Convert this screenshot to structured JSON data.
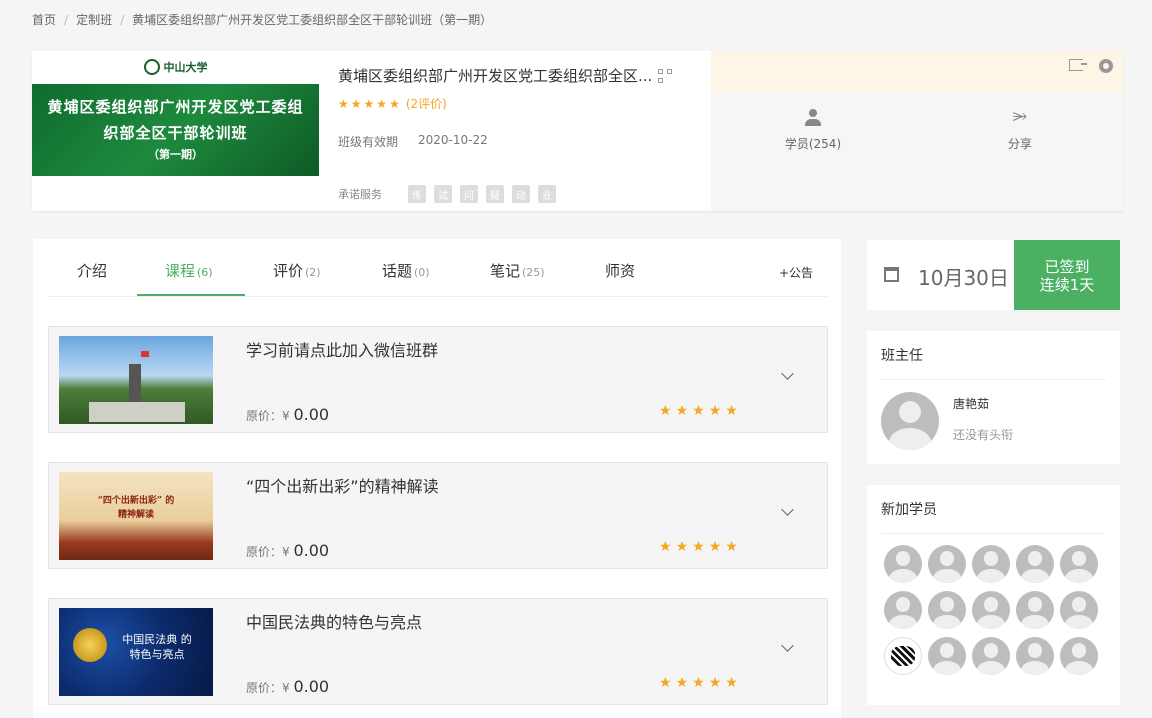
{
  "breadcrumb": {
    "home": "首页",
    "section": "定制班",
    "current": "黄埔区委组织部广州开发区党工委组织部全区干部轮训班（第一期）"
  },
  "cover": {
    "logo_text": "中山大学",
    "title_line1": "黄埔区委组织部广州开发区党工委组",
    "title_line2": "织部全区干部轮训班",
    "subtitle": "（第一期）"
  },
  "info": {
    "title": "黄埔区委组织部广州开发区党工委组织部全区...",
    "rating": 5,
    "rating_text": "(2评价)",
    "validity_label": "班级有效期",
    "validity_value": "2020-10-22",
    "promise_label": "承诺服务",
    "promise_badges": [
      "练",
      "试",
      "问",
      "疑",
      "动",
      "业"
    ]
  },
  "actions": {
    "students_label": "学员(254)",
    "share_label": "分享"
  },
  "tabs": [
    {
      "label": "介绍",
      "count": ""
    },
    {
      "label": "课程",
      "count": "(6)"
    },
    {
      "label": "评价",
      "count": "(2)"
    },
    {
      "label": "话题",
      "count": "(0)"
    },
    {
      "label": "笔记",
      "count": "(25)"
    },
    {
      "label": "师资",
      "count": ""
    }
  ],
  "notice_label": "+公告",
  "courses": [
    {
      "title": "学习前请点此加入微信班群",
      "price_label": "原价：¥",
      "price": "0.00",
      "rating": 5
    },
    {
      "title": "“四个出新出彩”的精神解读",
      "price_label": "原价：¥",
      "price": "0.00",
      "rating": 5,
      "thumb_text": "“四个出新出彩” 的精神解读"
    },
    {
      "title": "中国民法典的特色与亮点",
      "price_label": "原价：¥",
      "price": "0.00",
      "rating": 5,
      "thumb_text": "中国民法典 的特色与亮点"
    }
  ],
  "checkin": {
    "date": "10月30日",
    "status": "已签到",
    "streak": "连续1天"
  },
  "head_teacher": {
    "heading": "班主任",
    "name": "唐艳茹",
    "title": "还没有头衔"
  },
  "new_students": {
    "heading": "新加学员",
    "count_shown": 15
  },
  "colors": {
    "accent": "#4cb062",
    "star": "#f5a623",
    "banner": "#fdf5e6"
  }
}
